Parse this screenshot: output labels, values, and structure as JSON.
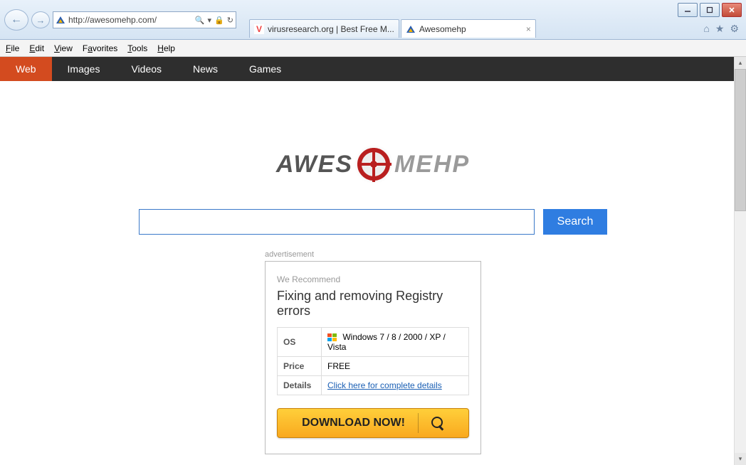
{
  "window": {
    "minimize_tip": "Minimize",
    "maximize_tip": "Maximize",
    "close_tip": "Close"
  },
  "nav": {
    "back_tip": "Back",
    "forward_tip": "Forward",
    "url": "http://awesomehp.com/",
    "search_glyph": "🔍",
    "dropdown_glyph": "▾",
    "cert_glyph": "🔒",
    "refresh_glyph": "↻"
  },
  "tabs": [
    {
      "title": "virusresearch.org | Best Free M...",
      "active": false,
      "favicon": "V"
    },
    {
      "title": "Awesomehp",
      "active": true,
      "favicon": "triangle"
    }
  ],
  "chrome_icons": {
    "home": "⌂",
    "star": "★",
    "gear": "⚙"
  },
  "menubar": [
    "File",
    "Edit",
    "View",
    "Favorites",
    "Tools",
    "Help"
  ],
  "categories": [
    {
      "label": "Web",
      "active": true
    },
    {
      "label": "Images",
      "active": false
    },
    {
      "label": "Videos",
      "active": false
    },
    {
      "label": "News",
      "active": false
    },
    {
      "label": "Games",
      "active": false
    }
  ],
  "logo": {
    "part1": "AWES",
    "part2": "MEHP"
  },
  "search": {
    "value": "",
    "placeholder": "",
    "button": "Search"
  },
  "ad": {
    "label": "advertisement",
    "recommend": "We Recommend",
    "title": "Fixing and removing Registry errors",
    "rows": {
      "os_label": "OS",
      "os_value": "Windows 7 / 8 / 2000 / XP / Vista",
      "price_label": "Price",
      "price_value": "FREE",
      "details_label": "Details",
      "details_link": "Click here for complete details"
    },
    "download": "DOWNLOAD NOW!"
  }
}
